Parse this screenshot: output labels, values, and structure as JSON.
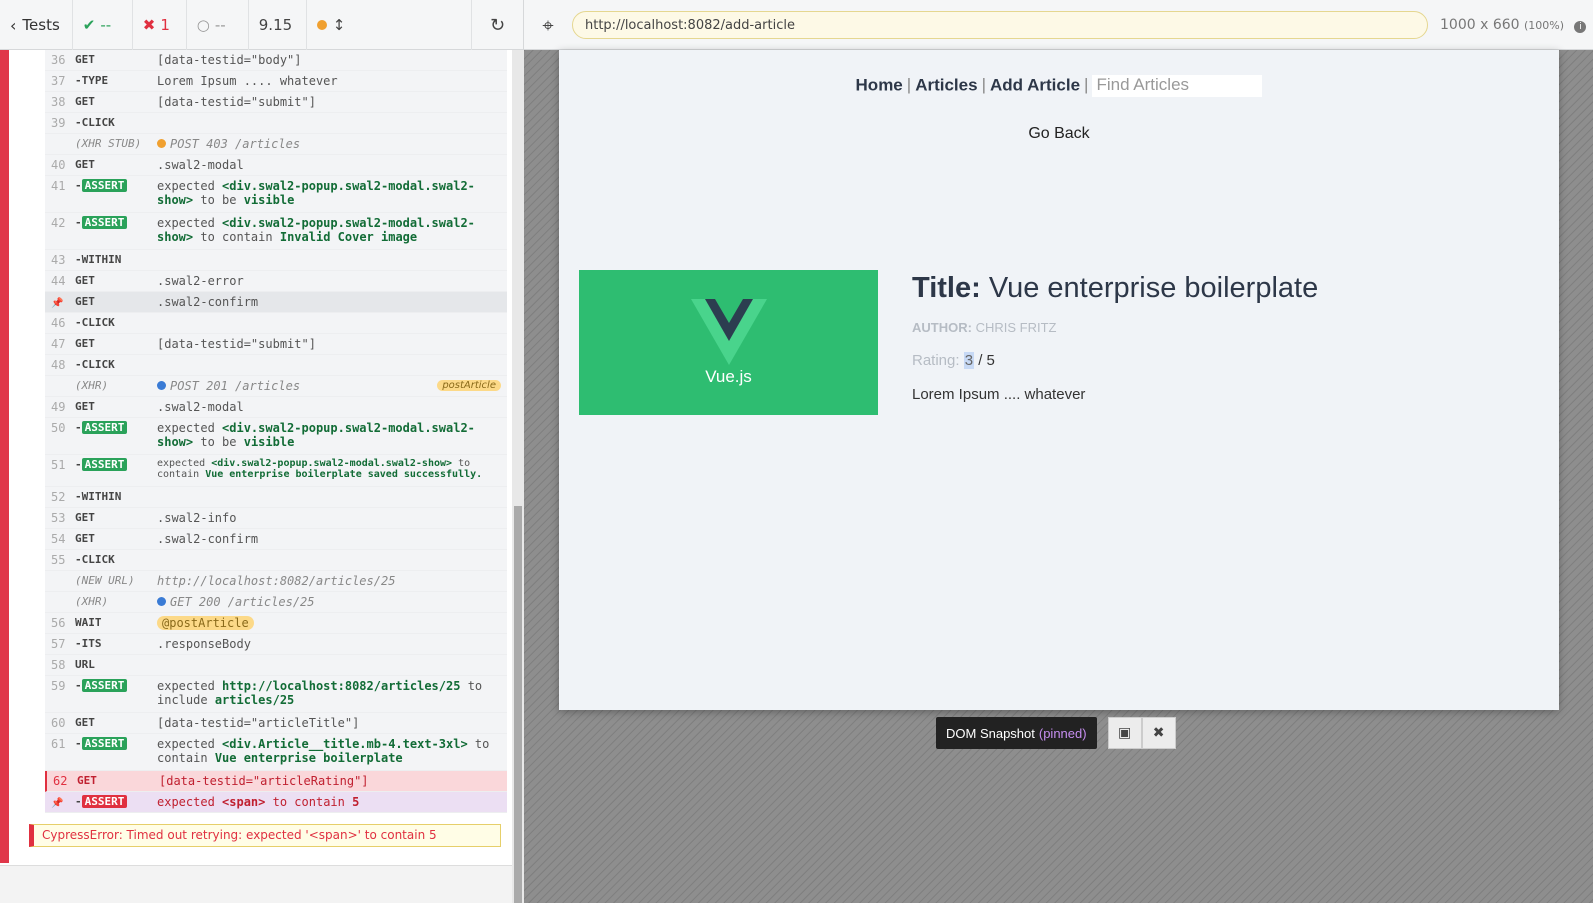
{
  "reporter_header": {
    "tests_label": "Tests",
    "passed": "--",
    "failed": "1",
    "pending": "--",
    "duration": "9.15"
  },
  "aut_header": {
    "url": "http://localhost:8082/add-article",
    "viewport": "1000 x 660",
    "zoom": "(100%)"
  },
  "commands": [
    {
      "num": "36",
      "name": "GET",
      "msg": "[data-testid=\"body\"]"
    },
    {
      "num": "37",
      "name": "-TYPE",
      "msg": "Lorem Ipsum .... whatever"
    },
    {
      "num": "38",
      "name": "GET",
      "msg": "[data-testid=\"submit\"]"
    },
    {
      "num": "39",
      "name": "-CLICK",
      "msg": ""
    },
    {
      "num": "",
      "name": "(XHR STUB)",
      "msg": "POST 403 /articles"
    },
    {
      "num": "40",
      "name": "GET",
      "msg": ".swal2-modal"
    },
    {
      "num": "41",
      "name": "-ASSERT",
      "pre": "expected",
      "subject": "<div.swal2-popup.swal2-modal.swal2-show>",
      "verb": "to be",
      "obj": "visible"
    },
    {
      "num": "42",
      "name": "-ASSERT",
      "pre": "expected",
      "subject": "<div.swal2-popup.swal2-modal.swal2-show>",
      "verb": "to contain",
      "obj": "Invalid Cover image"
    },
    {
      "num": "43",
      "name": "-WITHIN",
      "msg": ""
    },
    {
      "num": "44",
      "name": "GET",
      "msg": ".swal2-error"
    },
    {
      "num": "",
      "name": "GET",
      "msg": ".swal2-confirm"
    },
    {
      "num": "46",
      "name": "-CLICK",
      "msg": ""
    },
    {
      "num": "47",
      "name": "GET",
      "msg": "[data-testid=\"submit\"]"
    },
    {
      "num": "48",
      "name": "-CLICK",
      "msg": ""
    },
    {
      "num": "",
      "name": "(XHR)",
      "msg": "POST 201 /articles",
      "alias": "postArticle"
    },
    {
      "num": "49",
      "name": "GET",
      "msg": ".swal2-modal"
    },
    {
      "num": "50",
      "name": "-ASSERT",
      "pre": "expected",
      "subject": "<div.swal2-popup.swal2-modal.swal2-show>",
      "verb": "to be",
      "obj": "visible"
    },
    {
      "num": "51",
      "name": "-ASSERT",
      "pre": "expected",
      "subject": "<div.swal2-popup.swal2-modal.swal2-show>",
      "verb": "to contain",
      "obj": "Vue enterprise boilerplate saved successfully."
    },
    {
      "num": "52",
      "name": "-WITHIN",
      "msg": ""
    },
    {
      "num": "53",
      "name": "GET",
      "msg": ".swal2-info"
    },
    {
      "num": "54",
      "name": "GET",
      "msg": ".swal2-confirm"
    },
    {
      "num": "55",
      "name": "-CLICK",
      "msg": ""
    },
    {
      "num": "",
      "name": "(NEW URL)",
      "msg": "http://localhost:8082/articles/25"
    },
    {
      "num": "",
      "name": "(XHR)",
      "msg": "GET 200 /articles/25"
    },
    {
      "num": "56",
      "name": "WAIT",
      "msg": "@postArticle"
    },
    {
      "num": "57",
      "name": "-ITS",
      "msg": ".responseBody"
    },
    {
      "num": "58",
      "name": "URL",
      "msg": ""
    },
    {
      "num": "59",
      "name": "-ASSERT",
      "pre": "expected",
      "subject": "http://localhost:8082/articles/25",
      "verb": "to include",
      "obj": "articles/25"
    },
    {
      "num": "60",
      "name": "GET",
      "msg": "[data-testid=\"articleTitle\"]"
    },
    {
      "num": "61",
      "name": "-ASSERT",
      "pre": "expected",
      "subject": "<div.Article__title.mb-4.text-3xl>",
      "verb": "to contain",
      "obj": "Vue enterprise boilerplate"
    },
    {
      "num": "62",
      "name": "GET",
      "msg": "[data-testid=\"articleRating\"]"
    },
    {
      "num": "",
      "name": "-ASSERT",
      "pre": "expected",
      "subject": "<span>",
      "verb": "to contain",
      "obj": "5"
    }
  ],
  "error_message": "CypressError: Timed out retrying: expected '<span>' to contain 5",
  "app": {
    "nav": {
      "home": "Home",
      "articles": "Articles",
      "add_article": "Add Article",
      "find_placeholder": "Find Articles"
    },
    "go_back": "Go Back",
    "image_caption": "Vue.js",
    "title_label": "Title:",
    "title_value": "Vue enterprise boilerplate",
    "author_label": "AUTHOR:",
    "author_value": "CHRIS FRITZ",
    "rating_label": "Rating:",
    "rating_value": "3",
    "rating_max": "/ 5",
    "body": "Lorem Ipsum .... whatever"
  },
  "snapshot": {
    "label": "DOM Snapshot",
    "pinned": "(pinned)"
  },
  "colors": {
    "passed": "#2aa25a",
    "failed": "#e03040",
    "vue_green": "#2ebd71",
    "pinned_purple": "#c68ef0"
  }
}
